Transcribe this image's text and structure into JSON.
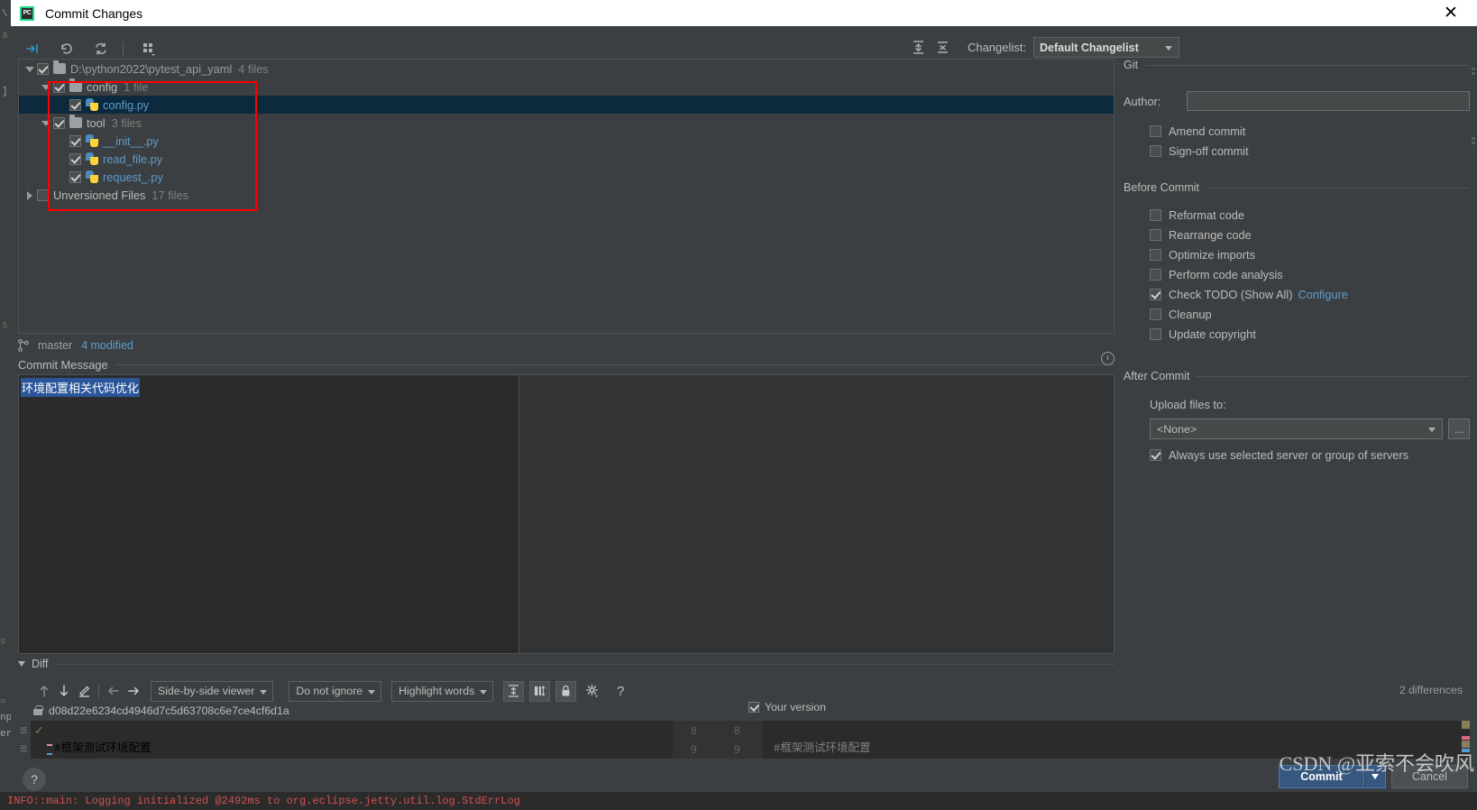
{
  "window": {
    "title": "Commit Changes",
    "logo_text": "PC",
    "close_icon": "close-icon"
  },
  "toolbar": {
    "buttons": [
      {
        "name": "show-diff-icon",
        "glyph": "→|"
      },
      {
        "name": "revert-icon",
        "glyph": "↶"
      },
      {
        "name": "refresh-icon",
        "glyph": "⟳"
      },
      {
        "name": "group-by-icon",
        "glyph": "░"
      }
    ],
    "expand_all_icon": "expand-all-icon",
    "collapse_all_icon": "collapse-all-icon",
    "changelist_label": "Changelist:",
    "changelist_value": "Default Changelist"
  },
  "tree": {
    "rows": [
      {
        "indent": 0,
        "twisty": "down",
        "checked": true,
        "icon": "folder",
        "label": "D:\\python2022\\pytest_api_yaml",
        "count": "4 files",
        "selected": false,
        "dim_label": true
      },
      {
        "indent": 1,
        "twisty": "down",
        "checked": true,
        "icon": "folder",
        "label": "config",
        "count": "1 file",
        "selected": false,
        "dim_label": false
      },
      {
        "indent": 2,
        "twisty": "none",
        "checked": true,
        "icon": "python",
        "label": "config.py",
        "count": "",
        "selected": true,
        "dim_label": false
      },
      {
        "indent": 1,
        "twisty": "down",
        "checked": true,
        "icon": "folder",
        "label": "tool",
        "count": "3 files",
        "selected": false,
        "dim_label": false
      },
      {
        "indent": 2,
        "twisty": "none",
        "checked": true,
        "icon": "python",
        "label": "__init__.py",
        "count": "",
        "selected": false,
        "dim_label": false
      },
      {
        "indent": 2,
        "twisty": "none",
        "checked": true,
        "icon": "python",
        "label": "read_file.py",
        "count": "",
        "selected": false,
        "dim_label": false
      },
      {
        "indent": 2,
        "twisty": "none",
        "checked": true,
        "icon": "python",
        "label": "request_.py",
        "count": "",
        "selected": false,
        "dim_label": false
      },
      {
        "indent": 0,
        "twisty": "right",
        "checked": false,
        "icon": "none",
        "label": "Unversioned Files",
        "count": "17 files",
        "selected": false,
        "dim_label": false
      }
    ],
    "highlight_box_color": "#ff0000"
  },
  "status": {
    "branch_icon": "git-branch-icon",
    "branch": "master",
    "modified": "4 modified"
  },
  "commit_message": {
    "section_label": "Commit Message",
    "value": "环境配置相关代码优化",
    "history_icon": "clock-icon"
  },
  "git_panel": {
    "section_title": "Git",
    "author_label": "Author:",
    "author_value": "",
    "checkboxes": [
      {
        "label": "Amend commit",
        "checked": false,
        "name": "amend-commit-checkbox"
      },
      {
        "label": "Sign-off commit",
        "checked": false,
        "name": "sign-off-commit-checkbox"
      }
    ]
  },
  "before_commit": {
    "section_title": "Before Commit",
    "checkboxes": [
      {
        "label": "Reformat code",
        "checked": false,
        "name": "reformat-code-checkbox"
      },
      {
        "label": "Rearrange code",
        "checked": false,
        "name": "rearrange-code-checkbox"
      },
      {
        "label": "Optimize imports",
        "checked": false,
        "name": "optimize-imports-checkbox"
      },
      {
        "label": "Perform code analysis",
        "checked": false,
        "name": "perform-code-analysis-checkbox"
      },
      {
        "label": "Check TODO (Show All)",
        "checked": true,
        "name": "check-todo-checkbox",
        "link": "Configure"
      },
      {
        "label": "Cleanup",
        "checked": false,
        "name": "cleanup-checkbox"
      },
      {
        "label": "Update copyright",
        "checked": false,
        "name": "update-copyright-checkbox"
      }
    ]
  },
  "after_commit": {
    "section_title": "After Commit",
    "upload_label": "Upload files to:",
    "upload_value": "<None>",
    "browse_label": "...",
    "always_use_label": "Always use selected server or group of servers",
    "always_use_checked": true
  },
  "diff": {
    "section_label": "Diff",
    "toolbar": {
      "prev_diff_icon": "arrow-up-icon",
      "next_diff_icon": "arrow-down-icon",
      "edit_icon": "pencil-icon",
      "accept_left_icon": "arrow-left-icon",
      "accept_right_icon": "arrow-right-icon",
      "viewer_mode": "Side-by-side viewer",
      "ignore_mode": "Do not ignore",
      "highlight_mode": "Highlight words",
      "collapse_unchanged_icon": "collapse-unchanged-icon",
      "whitespace_icon": "whitespace-icon",
      "lock_icon": "lock-icon",
      "settings_icon": "gear-icon",
      "help_icon": "question-icon"
    },
    "differences_count": "2 differences",
    "left_revision": "d08d22e6234cd4946d7c5d63708c6e7ce4cf6d1a",
    "right_revision": "Your version",
    "rows": [
      {
        "left_num": "",
        "right_num": "",
        "left_text": "",
        "right_text": "",
        "marker": "check",
        "line_num_left": "8",
        "line_num_right": "8"
      },
      {
        "left_num": "9",
        "right_num": "9",
        "left_text": "#框架测试环境配置",
        "right_text": "#框架测试环境配置",
        "marker": "changed",
        "line_num_left": "9",
        "line_num_right": "9"
      }
    ]
  },
  "footer": {
    "help_label": "?",
    "commit_label": "Commit",
    "commit_dropdown_icon": "chevron-down-icon",
    "cancel_label": "Cancel"
  },
  "watermark": "CSDN @亚索不会吹风",
  "console": {
    "log_line": "INFO::main: Logging initialized @2492ms to org.eclipse.jetty.util.log.StdErrLog"
  },
  "colors": {
    "accent_blue": "#5c9ccc",
    "selection_blue": "#0d293e",
    "highlight_red": "#ff0000",
    "commit_button": "#365880",
    "log_red": "#d25252"
  }
}
